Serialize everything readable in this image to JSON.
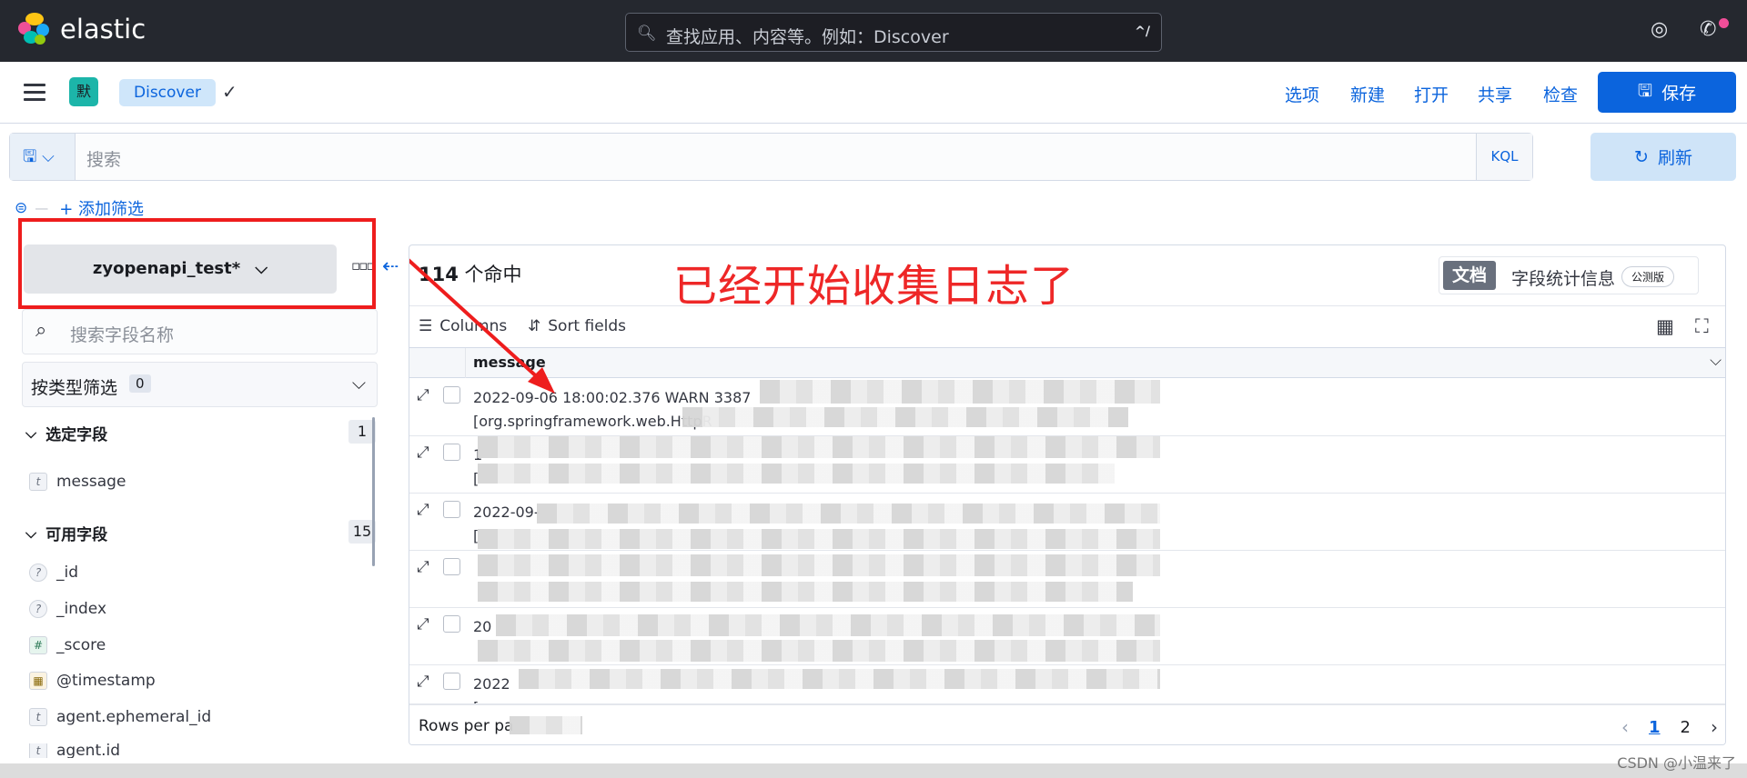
{
  "header": {
    "brand": "elastic",
    "search_placeholder": "查找应用、内容等。例如：Discover",
    "search_shortcut": "^/"
  },
  "toolbar": {
    "space_initial": "默",
    "breadcrumb": "Discover",
    "links": [
      "选项",
      "新建",
      "打开",
      "共享",
      "检查"
    ],
    "save_label": "保存"
  },
  "query": {
    "placeholder": "搜索",
    "language": "KQL",
    "refresh_label": "刷新",
    "add_filter_label": "+ 添加筛选"
  },
  "sidebar": {
    "data_view": "zyopenapi_test*",
    "field_search_placeholder": "搜索字段名称",
    "type_filter_label": "按类型筛选",
    "type_filter_count": "0",
    "selected_group": {
      "label": "选定字段",
      "count": "1",
      "fields": [
        {
          "type": "t",
          "name": "message"
        }
      ]
    },
    "available_group": {
      "label": "可用字段",
      "count": "15",
      "fields": [
        {
          "type": "?",
          "name": "_id"
        },
        {
          "type": "?",
          "name": "_index"
        },
        {
          "type": "#",
          "name": "_score"
        },
        {
          "type": "▦",
          "name": "@timestamp"
        },
        {
          "type": "t",
          "name": "agent.ephemeral_id"
        },
        {
          "type": "t",
          "name": "agent.id"
        }
      ]
    }
  },
  "main": {
    "hits_count": "114",
    "hits_suffix": "个命中",
    "annotation": "已经开始收集日志了",
    "tab_documents": "文档",
    "tab_field_stats": "字段统计信息",
    "beta_badge": "公测版",
    "columns_label": "Columns",
    "sort_label": "Sort fields",
    "column_header": "message",
    "rows": [
      {
        "line1": "2022-09-06 18:00:02.376 WARN 3387",
        "line2": "[org.springframework.web.HttpR"
      },
      {
        "line1": "1",
        "line2": "["
      },
      {
        "line1": "2022-09-",
        "line2": "["
      },
      {
        "line1": "",
        "line2": ""
      },
      {
        "line1": "20",
        "line2": ""
      },
      {
        "line1": "2022",
        "line2": "["
      }
    ],
    "rows_per_page": "Rows per pa",
    "pages": [
      "1",
      "2"
    ]
  },
  "watermark": "CSDN @小温来了",
  "colors": {
    "accent": "#0b64dd",
    "annotation": "#ee2727",
    "header_bg": "#25282f"
  },
  "icons": [
    "search-icon",
    "help-icon",
    "news-icon",
    "hamburger-icon",
    "check-icon",
    "save-icon",
    "refresh-icon",
    "filter-icon",
    "chevron-down-icon",
    "expand-icon",
    "table-icon",
    "fullscreen-icon",
    "chevron-left-icon",
    "chevron-right-icon"
  ]
}
